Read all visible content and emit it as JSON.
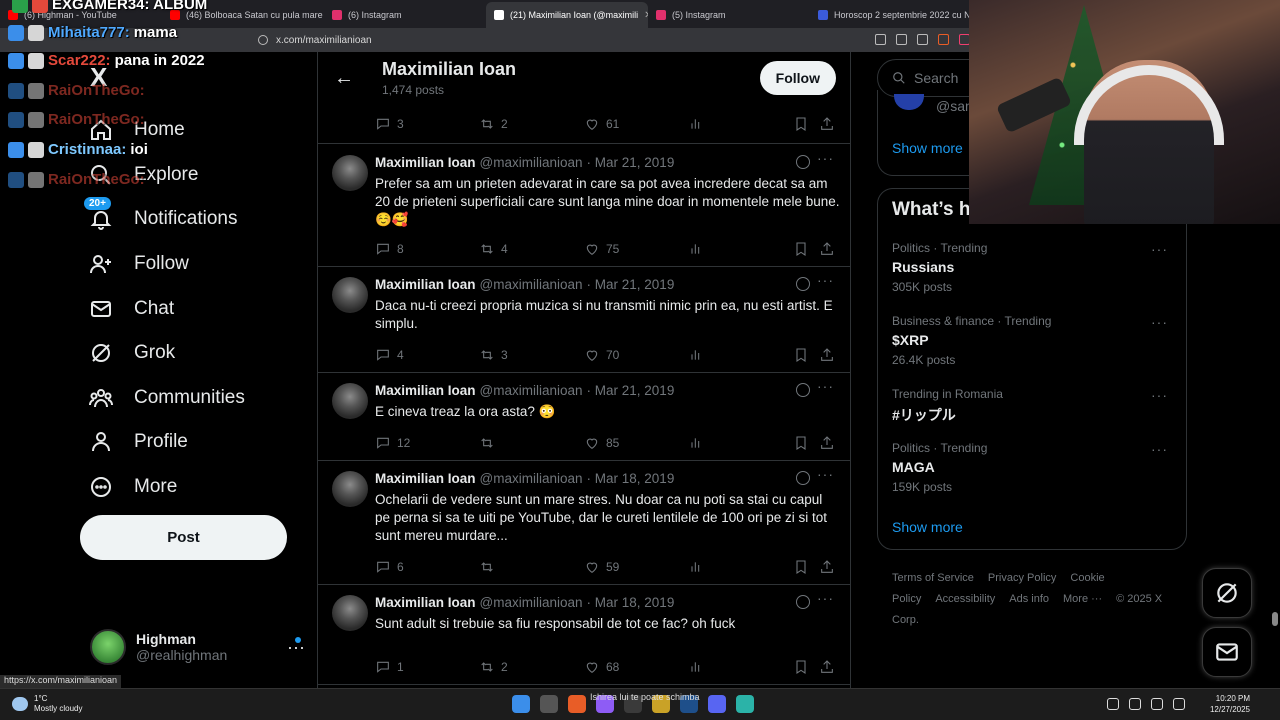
{
  "browser": {
    "tabs": [
      {
        "label": "(6) Highman - YouTube",
        "color": "#ff0000",
        "active": false
      },
      {
        "label": "(46) Bolboaca Satan cu pula mare - Y",
        "color": "#ff0000",
        "active": false
      },
      {
        "label": "(6) Instagram",
        "color": "#e1306c",
        "active": false
      },
      {
        "label": "(21) Maximilian Ioan (@maximili",
        "color": "#ffffff",
        "active": true
      },
      {
        "label": "(5) Instagram",
        "color": "#e1306c",
        "active": false
      },
      {
        "label": "Horoscop 2 septembrie 2022 cu Ne",
        "color": "#3b5bdb",
        "active": false
      }
    ],
    "url": "x.com/maximilianioan",
    "status_url": "https://x.com/maximilianioan"
  },
  "chat": {
    "header": "EXGAMER34: ALBUM",
    "lines": [
      {
        "user": "Mihaita777:",
        "msg": "mama",
        "color": "blue",
        "faded": false
      },
      {
        "user": "Scar222:",
        "msg": "pana in 2022",
        "color": "red",
        "faded": false
      },
      {
        "user": "RaiOnTheGo:",
        "msg": "",
        "color": "red",
        "faded": true
      },
      {
        "user": "RaiOnTheGo:",
        "msg": "",
        "color": "red",
        "faded": true
      },
      {
        "user": "Cristinnaa:",
        "msg": "ioi",
        "color": "cyan",
        "faded": false
      },
      {
        "user": "RaiOnTheGo:",
        "msg": "",
        "color": "red",
        "faded": true
      }
    ]
  },
  "nav": {
    "logo": "X",
    "items": [
      {
        "label": "Home",
        "icon": "home-icon"
      },
      {
        "label": "Explore",
        "icon": "search-icon"
      },
      {
        "label": "Notifications",
        "icon": "bell-icon",
        "badge": "20+"
      },
      {
        "label": "Follow",
        "icon": "add-person-icon"
      },
      {
        "label": "Chat",
        "icon": "mail-icon"
      },
      {
        "label": "Grok",
        "icon": "grok-icon"
      },
      {
        "label": "Communities",
        "icon": "communities-icon"
      },
      {
        "label": "Profile",
        "icon": "person-icon"
      },
      {
        "label": "More",
        "icon": "more-circle-icon"
      }
    ],
    "post_label": "Post",
    "account": {
      "name": "Highman",
      "handle": "@realhighman"
    }
  },
  "profile_header": {
    "name": "Maximilian Ioan",
    "posts_count": "1,474 posts",
    "follow_label": "Follow"
  },
  "previous_tweet_actions": {
    "replies": "3",
    "reposts": "2",
    "likes": "61"
  },
  "tweets": [
    {
      "name": "Maximilian Ioan",
      "handle": "@maximilianioan",
      "date": "· Mar 21, 2019",
      "text": "Prefer sa am un prieten adevarat in care sa pot avea incredere decat sa am 20 de prieteni superficiali care sunt langa mine doar in momentele mele bune. ☺️🥰",
      "replies": "8",
      "reposts": "4",
      "likes": "75"
    },
    {
      "name": "Maximilian Ioan",
      "handle": "@maximilianioan",
      "date": "· Mar 21, 2019",
      "text": "Daca nu-ti creezi propria muzica si nu transmiti nimic prin ea, nu esti artist. E simplu.",
      "replies": "4",
      "reposts": "3",
      "likes": "70"
    },
    {
      "name": "Maximilian Ioan",
      "handle": "@maximilianioan",
      "date": "· Mar 21, 2019",
      "text": "E cineva treaz la ora asta? 😳",
      "replies": "12",
      "reposts": "",
      "likes": "85"
    },
    {
      "name": "Maximilian Ioan",
      "handle": "@maximilianioan",
      "date": "· Mar 18, 2019",
      "text": "Ochelarii de vedere sunt un mare stres. Nu doar ca nu poti sa stai cu capul pe perna si sa te uiti pe YouTube, dar le cureti lentilele de 100 ori pe zi si tot sunt mereu murdare...",
      "replies": "6",
      "reposts": "",
      "likes": "59"
    },
    {
      "name": "Maximilian Ioan",
      "handle": "@maximilianioan",
      "date": "· Mar 18, 2019",
      "text": "Sunt adult si trebuie sa fiu responsabil de tot ce fac? oh fuck",
      "replies": "1",
      "reposts": "2",
      "likes": "68"
    }
  ],
  "sidebar": {
    "search_placeholder": "Search",
    "who_to_follow_handle": "@sam",
    "show_more": "Show more",
    "trends_title": "What’s ha",
    "trends": [
      {
        "meta": "Politics · Trending",
        "title": "Russians",
        "count": "305K posts"
      },
      {
        "meta": "Business & finance · Trending",
        "title": "$XRP",
        "count": "26.4K posts"
      },
      {
        "meta": "Trending in Romania",
        "title": "#リップル",
        "count": ""
      },
      {
        "meta": "Politics · Trending",
        "title": "MAGA",
        "count": "159K posts"
      }
    ],
    "footer": [
      "Terms of Service",
      "Privacy Policy",
      "Cookie Policy",
      "Accessibility",
      "Ads info",
      "More ···",
      "© 2025 X Corp."
    ]
  },
  "taskbar": {
    "temp": "1°C",
    "weather": "Mostly cloudy",
    "now_playing": "Ishirea lui te poate schimba",
    "time": "10:20 PM",
    "date": "12/27/2025"
  }
}
